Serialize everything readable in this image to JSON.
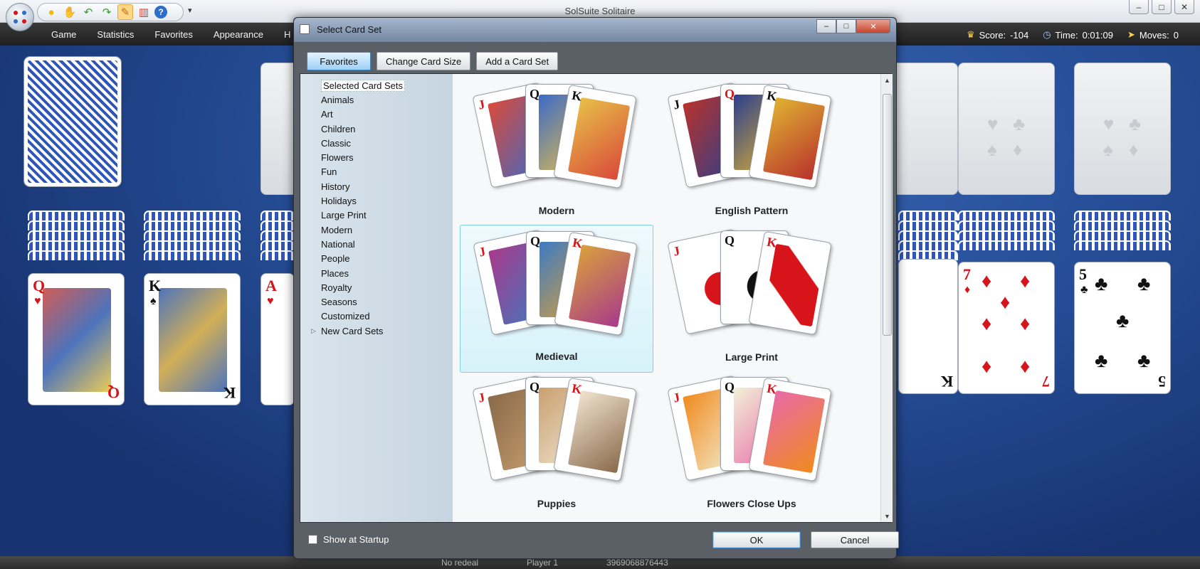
{
  "app": {
    "title": "SolSuite Solitaire",
    "window_controls": [
      "–",
      "□",
      "✕"
    ]
  },
  "quick_access": {
    "buttons": [
      "sun-icon",
      "hand-icon",
      "undo-icon",
      "redo-icon",
      "hint-icon",
      "chart-icon",
      "help-icon"
    ],
    "more": "▾"
  },
  "menu": {
    "items": [
      "Game",
      "Statistics",
      "Favorites",
      "Appearance",
      "H"
    ]
  },
  "status": {
    "score_label": "Score:",
    "score_value": "-104",
    "time_label": "Time:",
    "time_value": "0:01:09",
    "moves_label": "Moves:",
    "moves_value": "0"
  },
  "bottom_bar": {
    "redeal": "No redeal",
    "player": "Player 1",
    "game_number": "3969068876443"
  },
  "tableau_faces": [
    {
      "rank": "Q",
      "suit": "♥",
      "color": "red"
    },
    {
      "rank": "K",
      "suit": "♠",
      "color": "blk"
    },
    {
      "rank": "A",
      "suit": "♥",
      "color": "red"
    },
    {
      "rank": "K",
      "suit": "♠",
      "color": "blk"
    },
    {
      "rank": "7",
      "suit": "♦",
      "color": "red"
    },
    {
      "rank": "5",
      "suit": "♣",
      "color": "blk"
    }
  ],
  "dialog": {
    "title": "Select Card Set",
    "toolbar": {
      "favorites": "Favorites",
      "change_size": "Change Card Size",
      "add_set": "Add a Card Set"
    },
    "categories": [
      "Selected Card Sets",
      "Animals",
      "Art",
      "Children",
      "Classic",
      "Flowers",
      "Fun",
      "History",
      "Holidays",
      "Large Print",
      "Modern",
      "National",
      "People",
      "Places",
      "Royalty",
      "Seasons",
      "Customized",
      "New Card Sets"
    ],
    "tiles": [
      {
        "name": "Modern",
        "selected": false
      },
      {
        "name": "English Pattern",
        "selected": false
      },
      {
        "name": "Medieval",
        "selected": true
      },
      {
        "name": "Large Print",
        "selected": false
      },
      {
        "name": "Puppies",
        "selected": false
      },
      {
        "name": "Flowers Close Ups",
        "selected": false
      }
    ],
    "mini_ranks": [
      "J",
      "Q",
      "K"
    ],
    "footer": {
      "show_at_startup": "Show at Startup",
      "show_at_startup_checked": false,
      "ok": "OK",
      "cancel": "Cancel"
    }
  },
  "colors": {
    "selected_tile_border": "#7fd0e8",
    "favorites_active": "#9fd0f5",
    "red_suit": "#d7141a"
  }
}
